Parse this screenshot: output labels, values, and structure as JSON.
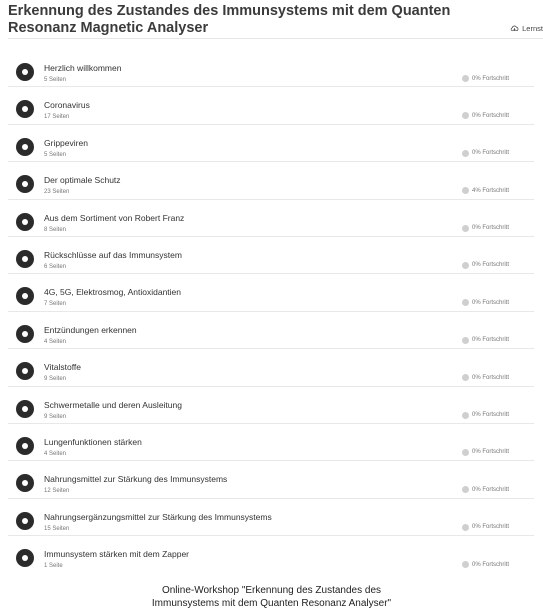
{
  "header": {
    "title": "Erkennung des Zustandes des Immunsystems mit dem Quanten Resonanz Magnetic Analyser",
    "action_label": "Lernst"
  },
  "lessons": [
    {
      "title": "Herzlich willkommen",
      "pages": "5 Seiten",
      "progress": "0% Fortschritt"
    },
    {
      "title": "Coronavirus",
      "pages": "17 Seiten",
      "progress": "0% Fortschritt"
    },
    {
      "title": "Grippeviren",
      "pages": "5 Seiten",
      "progress": "0% Fortschritt"
    },
    {
      "title": "Der optimale Schutz",
      "pages": "23 Seiten",
      "progress": "4% Fortschritt"
    },
    {
      "title": "Aus dem Sortiment von Robert Franz",
      "pages": "8 Seiten",
      "progress": "0% Fortschritt"
    },
    {
      "title": "Rückschlüsse auf das Immunsystem",
      "pages": "6 Seiten",
      "progress": "0% Fortschritt"
    },
    {
      "title": "4G, 5G, Elektrosmog, Antioxidantien",
      "pages": "7 Seiten",
      "progress": "0% Fortschritt"
    },
    {
      "title": "Entzündungen erkennen",
      "pages": "4 Seiten",
      "progress": "0% Fortschritt"
    },
    {
      "title": "Vitalstoffe",
      "pages": "9 Seiten",
      "progress": "0% Fortschritt"
    },
    {
      "title": "Schwermetalle und deren Ausleitung",
      "pages": "9 Seiten",
      "progress": "0% Fortschritt"
    },
    {
      "title": "Lungenfunktionen stärken",
      "pages": "4 Seiten",
      "progress": "0% Fortschritt"
    },
    {
      "title": "Nahrungsmittel zur Stärkung des Immunsystems",
      "pages": "12 Seiten",
      "progress": "0% Fortschritt"
    },
    {
      "title": "Nahrungsergänzungsmittel zur Stärkung des Immunsystems",
      "pages": "15 Seiten",
      "progress": "0% Fortschritt"
    },
    {
      "title": "Immunsystem stärken mit dem Zapper",
      "pages": "1 Seite",
      "progress": "0% Fortschritt"
    }
  ],
  "caption": {
    "line1": "Online-Workshop \"Erkennung des Zustandes des",
    "line2": "Immunsystems mit dem Quanten Resonanz Analyser\""
  }
}
